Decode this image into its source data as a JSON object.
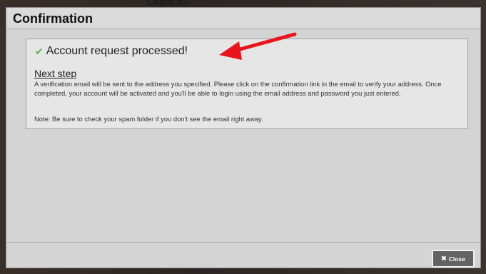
{
  "background": {
    "partial_text": "Login ID"
  },
  "dialog": {
    "title": "Confirmation",
    "success": {
      "icon": "check-icon",
      "message": "Account request processed!"
    },
    "next_step": {
      "heading": "Next step",
      "body": "A verification email will be sent to the address you specified. Please click on the confirmation link in the email to verify your address. Once completed, your account will be activated and you'll be able to login using the email address and password you just entered.",
      "note": "Note: Be sure to check your spam folder if you don't see the email right away."
    },
    "close_button": {
      "icon": "close-icon",
      "label": "Close"
    }
  },
  "colors": {
    "arrow": "#e8161c",
    "check": "#5fae4f",
    "close_button_bg": "#636363"
  }
}
